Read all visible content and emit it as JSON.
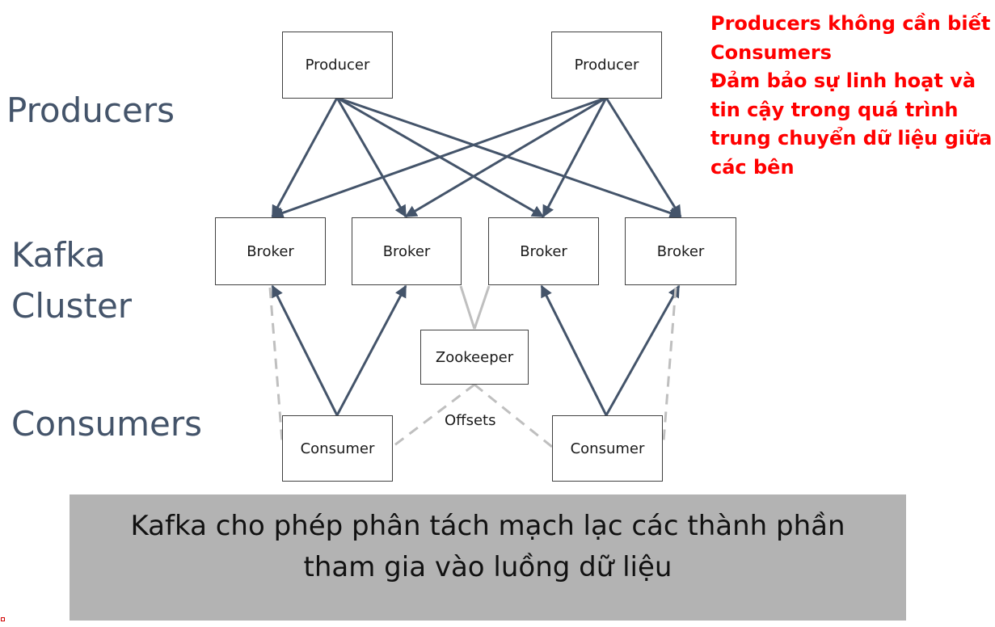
{
  "layers": {
    "producers": "Producers",
    "cluster_line1": "Kafka",
    "cluster_line2": "Cluster",
    "consumers": "Consumers"
  },
  "nodes": {
    "producer_1": "Producer",
    "producer_2": "Producer",
    "broker_1": "Broker",
    "broker_2": "Broker",
    "broker_3": "Broker",
    "broker_4": "Broker",
    "zookeeper": "Zookeeper",
    "consumer_1": "Consumer",
    "consumer_2": "Consumer"
  },
  "offsets_label": "Offsets",
  "note": {
    "line1": "Producers không cần biết",
    "line2": "Consumers",
    "line3": "Đảm bảo sự linh hoạt và",
    "line4": "tin cậy trong quá trình",
    "line5": "trung chuyển dữ liệu giữa",
    "line6": "các bên"
  },
  "banner": {
    "line1": "Kafka cho phép phân tách mạch lạc các thành phần",
    "line2": "tham gia vào luồng dữ liệu"
  },
  "colors": {
    "arrow": "#44546a",
    "dashed": "#bfbfbf",
    "note": "#ff0000",
    "banner_bg": "#b3b3b3",
    "layer_label": "#44546a"
  }
}
